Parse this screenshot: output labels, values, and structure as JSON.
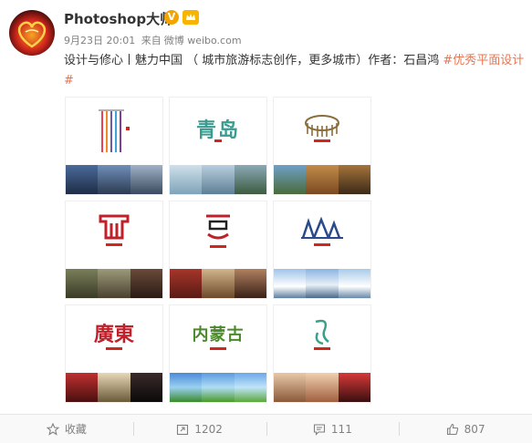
{
  "user": {
    "name": "Photoshop大师",
    "verified_mark": "V"
  },
  "meta": {
    "date": "9月23日 20:01",
    "source_prefix": "来自",
    "source": "微博 weibo.com"
  },
  "post": {
    "text": "设计与修心丨魅力中国 （ 城市旅游标志创作，更多城市）作者：石昌鸿 ",
    "hashtag": "#优秀平面设计#"
  },
  "grid": {
    "cells": [
      {
        "logo": "",
        "label": "logo-1"
      },
      {
        "logo": "青岛",
        "label": "logo-qingdao"
      },
      {
        "logo": "",
        "label": "logo-3"
      },
      {
        "logo": "",
        "label": "logo-4"
      },
      {
        "logo": "",
        "label": "logo-5"
      },
      {
        "logo": "",
        "label": "logo-6"
      },
      {
        "logo": "廣東",
        "label": "logo-guangdong"
      },
      {
        "logo": "内蒙古",
        "label": "logo-neimenggu"
      },
      {
        "logo": "",
        "label": "logo-9"
      }
    ]
  },
  "actions": {
    "favorite": "收藏",
    "repost": "1202",
    "comment": "111",
    "like": "807"
  },
  "colors": {
    "hashtag": "#eb7350",
    "meta": "#808080",
    "verified": "#f2a400"
  },
  "icons": {
    "favorite": "star-icon",
    "repost": "repost-icon",
    "comment": "comment-icon",
    "like": "thumbs-up-icon"
  }
}
